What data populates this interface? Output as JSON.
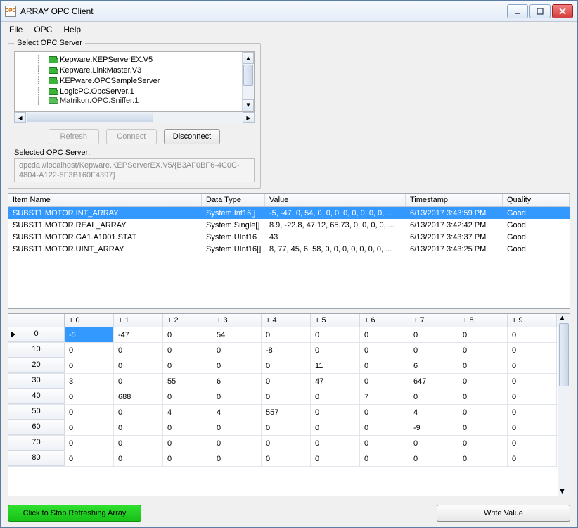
{
  "window": {
    "title": "ARRAY OPC Client",
    "icon_label": "OPC"
  },
  "menu": {
    "file": "File",
    "opc": "OPC",
    "help": "Help"
  },
  "server_group": {
    "legend": "Select OPC Server",
    "items": [
      "Kepware.KEPServerEX.V5",
      "Kepware.LinkMaster.V3",
      "KEPware.OPCSampleServer",
      "LogicPC.OpcServer.1",
      "Matrikon.OPC.Sniffer.1"
    ],
    "buttons": {
      "refresh": "Refresh",
      "connect": "Connect",
      "disconnect": "Disconnect"
    },
    "selected_label": "Selected OPC Server:",
    "selected_value": "opcda://localhost/Kepware.KEPServerEX.V5/{B3AF0BF6-4C0C-4804-A122-6F3B160F4397}"
  },
  "items_grid": {
    "columns": {
      "name": "Item Name",
      "dtype": "Data Type",
      "value": "Value",
      "timestamp": "Timestamp",
      "quality": "Quality"
    },
    "rows": [
      {
        "name": "SUBST1.MOTOR.INT_ARRAY",
        "dtype": "System.Int16[]",
        "value": "-5, -47, 0, 54, 0, 0, 0, 0, 0, 0, 0, 0, ...",
        "timestamp": "6/13/2017 3:43:59 PM",
        "quality": "Good",
        "selected": true
      },
      {
        "name": "SUBST1.MOTOR.REAL_ARRAY",
        "dtype": "System.Single[]",
        "value": "8.9, -22.8, 47.12, 65.73, 0, 0, 0, 0, ...",
        "timestamp": "6/13/2017 3:42:42 PM",
        "quality": "Good"
      },
      {
        "name": "SUBST1.MOTOR.GA1.A1001.STAT",
        "dtype": "System.UInt16",
        "value": "43",
        "timestamp": "6/13/2017 3:43:37 PM",
        "quality": "Good"
      },
      {
        "name": "SUBST1.MOTOR.UINT_ARRAY",
        "dtype": "System.UInt16[]",
        "value": "8, 77, 45, 6, 58, 0, 0, 0, 0, 0, 0, 0, ...",
        "timestamp": "6/13/2017 3:43:25 PM",
        "quality": "Good"
      }
    ]
  },
  "array_grid": {
    "col_headers": [
      "+ 0",
      "+ 1",
      "+ 2",
      "+ 3",
      "+ 4",
      "+ 5",
      "+ 6",
      "+ 7",
      "+ 8",
      "+ 9"
    ],
    "row_headers": [
      "0",
      "10",
      "20",
      "30",
      "40",
      "50",
      "60",
      "70",
      "80"
    ],
    "selected": {
      "r": 0,
      "c": 0
    },
    "data": [
      [
        "-5",
        "-47",
        "0",
        "54",
        "0",
        "0",
        "0",
        "0",
        "0",
        "0"
      ],
      [
        "0",
        "0",
        "0",
        "0",
        "-8",
        "0",
        "0",
        "0",
        "0",
        "0"
      ],
      [
        "0",
        "0",
        "0",
        "0",
        "0",
        "11",
        "0",
        "6",
        "0",
        "0"
      ],
      [
        "3",
        "0",
        "55",
        "6",
        "0",
        "47",
        "0",
        "647",
        "0",
        "0"
      ],
      [
        "0",
        "688",
        "0",
        "0",
        "0",
        "0",
        "7",
        "0",
        "0",
        "0"
      ],
      [
        "0",
        "0",
        "4",
        "4",
        "557",
        "0",
        "0",
        "4",
        "0",
        "0"
      ],
      [
        "0",
        "0",
        "0",
        "0",
        "0",
        "0",
        "0",
        "-9",
        "0",
        "0"
      ],
      [
        "0",
        "0",
        "0",
        "0",
        "0",
        "0",
        "0",
        "0",
        "0",
        "0"
      ],
      [
        "0",
        "0",
        "0",
        "0",
        "0",
        "0",
        "0",
        "0",
        "0",
        "0"
      ]
    ]
  },
  "footer": {
    "refresh_btn": "Click to Stop Refreshing Array",
    "write_btn": "Write Value"
  }
}
